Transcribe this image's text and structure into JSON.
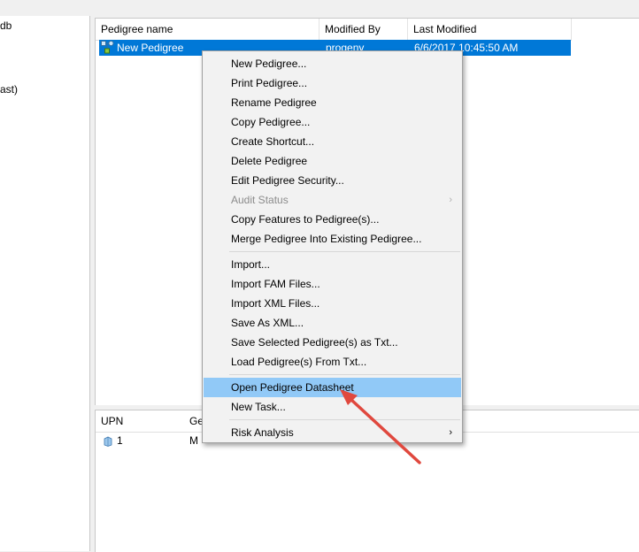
{
  "tree": {
    "fragments": [
      "db",
      "ast)"
    ]
  },
  "pedigree_list": {
    "columns": [
      "Pedigree name",
      "Modified By",
      "Last Modified"
    ],
    "rows": [
      {
        "name": "New Pedigree",
        "modified_by": "progeny",
        "last_modified": "6/6/2017 10:45:50 AM",
        "selected": true
      }
    ]
  },
  "individuals_grid": {
    "columns": [
      "UPN",
      "Ge"
    ],
    "rows": [
      {
        "upn": "1",
        "ge": "M"
      }
    ]
  },
  "context_menu": {
    "group1": [
      {
        "label": "New Pedigree...",
        "enabled": true
      },
      {
        "label": "Print Pedigree...",
        "enabled": true
      },
      {
        "label": "Rename Pedigree",
        "enabled": true
      },
      {
        "label": "Copy Pedigree...",
        "enabled": true
      },
      {
        "label": "Create Shortcut...",
        "enabled": true
      },
      {
        "label": "Delete Pedigree",
        "enabled": true
      },
      {
        "label": "Edit Pedigree Security...",
        "enabled": true
      },
      {
        "label": "Audit Status",
        "enabled": false,
        "submenu": true
      },
      {
        "label": "Copy Features to Pedigree(s)...",
        "enabled": true
      },
      {
        "label": "Merge Pedigree Into Existing Pedigree...",
        "enabled": true
      }
    ],
    "group2": [
      {
        "label": "Import...",
        "enabled": true
      },
      {
        "label": "Import FAM Files...",
        "enabled": true
      },
      {
        "label": "Import XML Files...",
        "enabled": true
      },
      {
        "label": "Save As XML...",
        "enabled": true
      },
      {
        "label": "Save Selected Pedigree(s) as Txt...",
        "enabled": true
      },
      {
        "label": "Load Pedigree(s) From Txt...",
        "enabled": true
      }
    ],
    "group3": [
      {
        "label": "Open Pedigree Datasheet",
        "enabled": true,
        "highlighted": true
      },
      {
        "label": "New Task...",
        "enabled": true
      }
    ],
    "group4": [
      {
        "label": "Risk Analysis",
        "enabled": true,
        "submenu": true
      }
    ],
    "submenu_glyph": "›"
  },
  "colors": {
    "selection_blue": "#0078d7",
    "menu_highlight": "#91c9f7",
    "annotation_red": "#e0483e"
  },
  "icons": {
    "pedigree": "pedigree-icon",
    "individual": "individual-icon"
  }
}
